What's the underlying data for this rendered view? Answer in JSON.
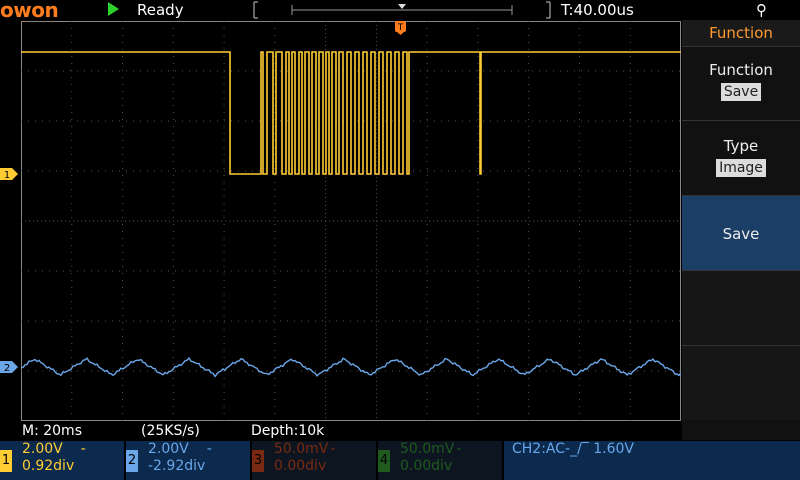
{
  "header": {
    "logo": "owon",
    "status": "Ready",
    "timebase_readout": "T:40.00us",
    "trigger_marker": "T"
  },
  "menu": {
    "title": "Function",
    "items": [
      {
        "label": "Function",
        "value": "Save"
      },
      {
        "label": "Type",
        "value": "Image"
      },
      {
        "label": "Save"
      }
    ]
  },
  "info": {
    "timebase": "M: 20ms",
    "sample_rate": "(25KS/s)",
    "depth": "Depth:10k"
  },
  "channels": [
    {
      "num": "1",
      "volts": "2.00V",
      "coupling": "-",
      "offset": "0.92div"
    },
    {
      "num": "2",
      "volts": "2.00V",
      "coupling": "-",
      "offset": "-2.92div"
    },
    {
      "num": "3",
      "volts": "50.0mV",
      "coupling": "-",
      "offset": "0.00div"
    },
    {
      "num": "4",
      "volts": "50.0mV",
      "coupling": "-",
      "offset": "0.00div"
    }
  ],
  "trigger_info": "CH2:AC-_/‾ 1.60V",
  "channel_markers": {
    "ch1": "1",
    "ch2": "2"
  },
  "colors": {
    "ch1": "#ffcc33",
    "ch2": "#6aa6e8",
    "ch3_dim": "#7a2a12",
    "ch4_dim": "#1f5a1f",
    "logo": "#ff7d1e",
    "run": "#2cd12c",
    "menu_accent": "#ff9a2e",
    "menu_selected": "#1a3e66"
  },
  "icons": {
    "run": "play-triangle",
    "usb": "usb-icon"
  }
}
